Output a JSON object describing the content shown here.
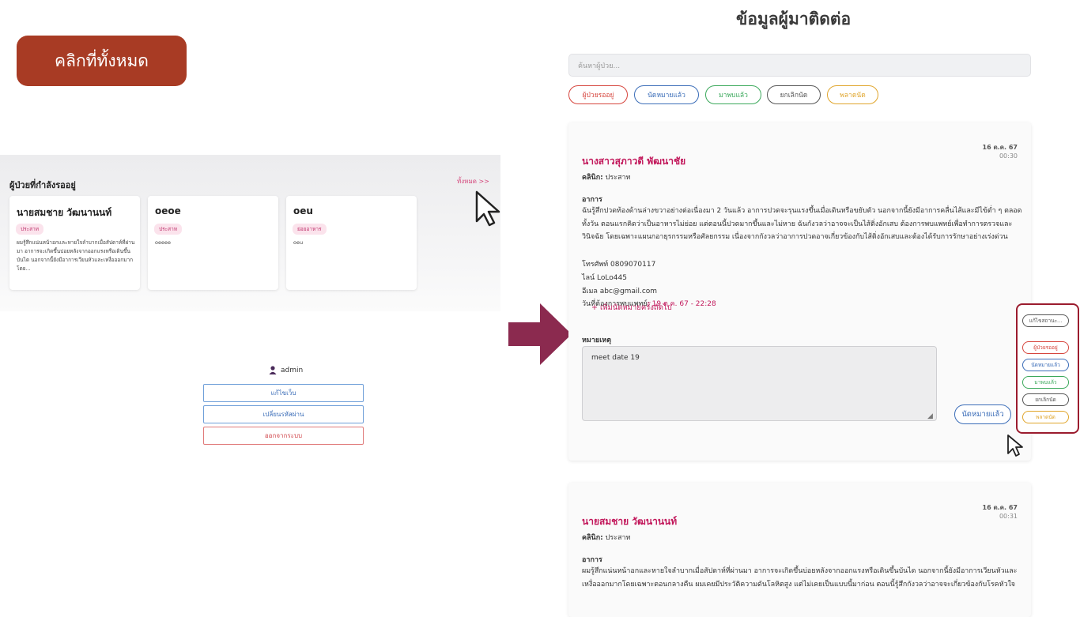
{
  "banner": {
    "label": "คลิกที่ทั้งหมด"
  },
  "left_panel": {
    "title": "ผู้ป่วยที่กำลังรออยู่",
    "see_all": "ทั้งหมด >>",
    "cards": [
      {
        "name": "นายสมชาย วัฒนานนท์",
        "tag": "ประสาท",
        "desc": "ผมรู้สึกแน่นหน้าอกและหายใจลำบากเมื่อสัปดาห์ที่ผ่านมา อาการจะเกิดขึ้นบ่อยหลังจากออกแรงหรือเดินขึ้นบันได นอกจากนี้ยังมีอาการเวียนหัวและเหงื่อออกมากโดย..."
      },
      {
        "name": "oeoe",
        "tag": "ประสาท",
        "desc": "oeeee"
      },
      {
        "name": "oeu",
        "tag": "ย่อยอาหาร",
        "desc": "oeu"
      }
    ]
  },
  "admin_menu": {
    "username": "admin",
    "edit_web": "แก้ไขเว็บ",
    "change_password": "เปลี่ยนรหัสผ่าน",
    "logout": "ออกจากระบบ"
  },
  "contacts": {
    "title": "ข้อมูลผู้มาติดต่อ",
    "search_placeholder": "ค้นหาผู้ป่วย...",
    "filters": [
      "ผู้ป่วยรออยู่",
      "นัดหมายแล้ว",
      "มาพบแล้ว",
      "ยกเลิกนัด",
      "พลาดนัด"
    ],
    "cards": [
      {
        "date": "16 ต.ค. 67",
        "time": "00:30",
        "name": "นางสาวสุภาวดี พัฒนาชัย",
        "clinic_label": "คลินิก:",
        "clinic": "ประสาท",
        "symptom_label": "อาการ",
        "symptom": "ฉันรู้สึกปวดท้องด้านล่างขวาอย่างต่อเนื่องมา 2 วันแล้ว อาการปวดจะรุนแรงขึ้นเมื่อเดินหรือขยับตัว นอกจากนี้ยังมีอาการคลื่นไส้และมีไข้ต่ำ ๆ ตลอดทั้งวัน ตอนแรกคิดว่าเป็นอาหารไม่ย่อย แต่ตอนนี้ปวดมากขึ้นและไม่หาย ฉันกังวลว่าอาจจะเป็นไส้ติ่งอักเสบ ต้องการพบแพทย์เพื่อทำการตรวจและวินิจฉัย โดยเฉพาะแผนกอายุรกรรมหรือศัลยกรรม เนื่องจากกังวลว่าอาการปวดอาจเกี่ยวข้องกับไส้ติ่งอักเสบและต้องได้รับการรักษาอย่างเร่งด่วน",
        "phone": "โทรศัพท์ 0809070117",
        "line": "ไลน์ LoLo445",
        "email": "อีเมล abc@gmail.com",
        "meet_label": "วันที่ต้องการพบแพทย์:",
        "meet_value": "19 ต.ค. 67 - 22:28",
        "add_next": "+ เพิ่มนัดหมายครั้งถัดไป",
        "note_label": "หมายเหตุ",
        "note": "meet date 19",
        "appoint_button": "นัดหมายแล้ว"
      },
      {
        "date": "16 ต.ค. 67",
        "time": "00:31",
        "name": "นายสมชาย วัฒนานนท์",
        "clinic_label": "คลินิก:",
        "clinic": "ประสาท",
        "symptom_label": "อาการ",
        "symptom": "ผมรู้สึกแน่นหน้าอกและหายใจลำบากเมื่อสัปดาห์ที่ผ่านมา อาการจะเกิดขึ้นบ่อยหลังจากออกแรงหรือเดินขึ้นบันได นอกจากนี้ยังมีอาการเวียนหัวและเหงื่อออกมากโดยเฉพาะตอนกลางคืน ผมเคยมีประวัติความดันโลหิตสูง แต่ไม่เคยเป็นแบบนี้มาก่อน ตอนนี้รู้สึกกังวลว่าอาจจะเกี่ยวข้องกับโรคหัวใจ"
      }
    ]
  },
  "status_popup": {
    "edit_status": "แก้ไขสถานะ...",
    "options": [
      "ผู้ป่วยรออยู่",
      "นัดหมายแล้ว",
      "มาพบแล้ว",
      "ยกเลิกนัด",
      "พลาดนัด"
    ]
  },
  "colors": {
    "banner": "#a83b24",
    "accent_pink": "#c2185b",
    "arrow": "#8b2a4f",
    "popup_border": "#9b1c2e",
    "status_waiting": "#d6453d",
    "status_appointed": "#3b6db8",
    "status_arrived": "#3aa85a",
    "status_cancelled": "#555555",
    "status_missed": "#e0a52b"
  }
}
